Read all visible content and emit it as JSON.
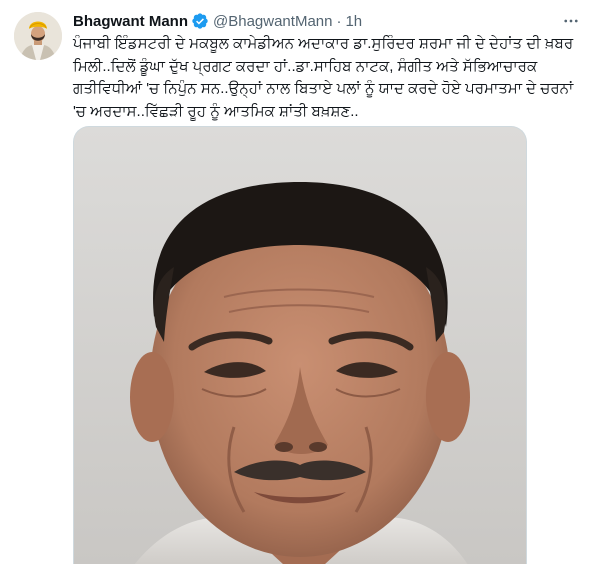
{
  "tweet": {
    "author": {
      "display_name": "Bhagwant Mann",
      "handle": "@BhagwantMann",
      "verified": true,
      "separator": "·",
      "time": "1h"
    },
    "text": "ਪੰਜਾਬੀ ਇੰਡਸਟਰੀ ਦੇ ਮਕਬੂਲ ਕਾਮੇਡੀਅਨ ਅਦਾਕਾਰ ਡਾ.ਸੁਰਿੰਦਰ ਸ਼ਰਮਾ ਜੀ ਦੇ ਦੇਹਾਂਤ ਦੀ ਖ਼ਬਰ ਮਿਲੀ..ਦਿਲੋਂ ਡੂੰਘਾ ਦੁੱਖ ਪ੍ਰਗਟ ਕਰਦਾ ਹਾਂ..ਡਾ.ਸਾਹਿਬ ਨਾਟਕ, ਸੰਗੀਤ ਅਤੇ ਸੱਭਿਆਚਾਰਕ ਗਤੀਵਿਧੀਆਂ 'ਚ ਨਿਪੁੰਨ ਸਨ..ਉਨ੍ਹਾਂ ਨਾਲ ਬਿਤਾਏ ਪਲਾਂ ਨੂੰ ਯਾਦ ਕਰਦੇ ਹੋਏ ਪਰਮਾਤਮਾ ਦੇ ਚਰਨਾਂ 'ਚ ਅਰਦਾਸ..ਵਿੱਛੜੀ ਰੂਹ ਨੂੰ ਆਤਮਿਕ ਸ਼ਾਂਤੀ ਬਖ਼ਸ਼ਣ..",
    "media": {
      "icon": "photo-portrait"
    },
    "more_icon": "more-horizontal-icon",
    "colors": {
      "verified_badge": "#1d9bf0",
      "secondary_text": "#536471",
      "primary_text": "#0f1419"
    }
  }
}
